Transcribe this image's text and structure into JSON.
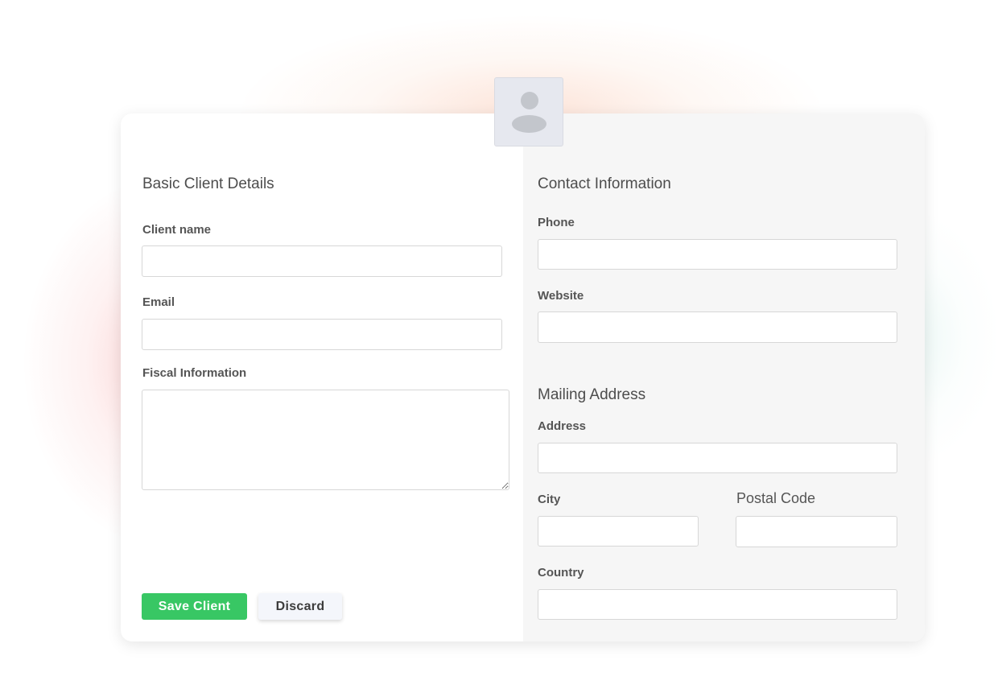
{
  "basic": {
    "title": "Basic Client Details",
    "client_name_label": "Client name",
    "client_name_value": "",
    "email_label": "Email",
    "email_value": "",
    "fiscal_label": "Fiscal Information",
    "fiscal_value": ""
  },
  "contact": {
    "title": "Contact Information",
    "phone_label": "Phone",
    "phone_value": "",
    "website_label": "Website",
    "website_value": ""
  },
  "mailing": {
    "title": "Mailing Address",
    "address_label": "Address",
    "address_value": "",
    "city_label": "City",
    "city_value": "",
    "postal_label": "Postal Code",
    "postal_value": "",
    "country_label": "Country",
    "country_value": ""
  },
  "actions": {
    "save_label": "Save Client",
    "discard_label": "Discard"
  },
  "icons": {
    "avatar": "user-placeholder-icon"
  },
  "colors": {
    "primary": "#38c764",
    "right_pane_bg": "#f6f6f6",
    "avatar_bg": "#e6e8ef"
  }
}
